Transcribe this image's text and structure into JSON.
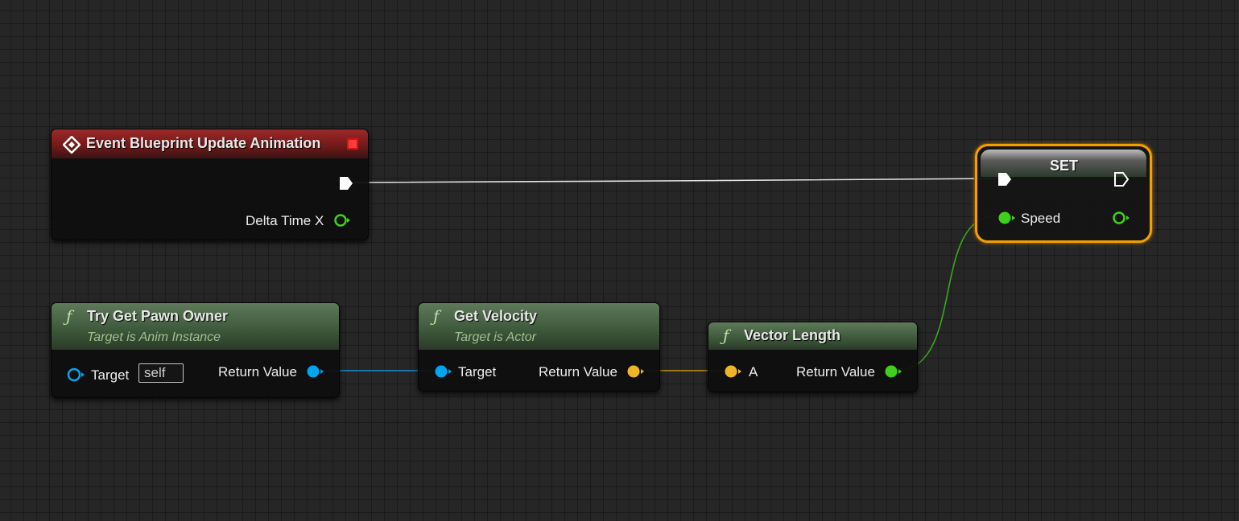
{
  "colors": {
    "exec": "#ffffff",
    "object": "#00a5f2",
    "vector": "#f0b526",
    "float": "#3fd01e",
    "event_header": "#8b1f1f",
    "function_header": "#4d6a49",
    "selection": "#f2a000"
  },
  "nodes": {
    "event": {
      "icon": "event-diamond-icon",
      "title": "Event Blueprint Update Animation",
      "out_pin_label": "Delta Time X"
    },
    "try_get_pawn_owner": {
      "icon": "function-icon",
      "title": "Try Get Pawn Owner",
      "subtitle": "Target is Anim Instance",
      "in_pin_label": "Target",
      "in_pin_value": "self",
      "out_pin_label": "Return Value"
    },
    "get_velocity": {
      "icon": "function-icon",
      "title": "Get Velocity",
      "subtitle": "Target is Actor",
      "in_pin_label": "Target",
      "out_pin_label": "Return Value"
    },
    "vector_length": {
      "icon": "function-icon",
      "title": "Vector Length",
      "in_pin_label": "A",
      "out_pin_label": "Return Value"
    },
    "set": {
      "title": "SET",
      "variable_label": "Speed",
      "selected": true
    }
  }
}
